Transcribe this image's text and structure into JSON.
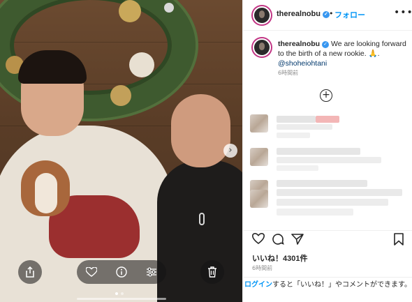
{
  "header": {
    "username": "therealnobu",
    "separator": "•",
    "follow_label": "フォロー",
    "more_label": "•••"
  },
  "caption": {
    "username": "therealnobu",
    "text": "We are looking forward to the birth of a new rookie.",
    "emoji": "🙏",
    "mention": "@shoheiohtani",
    "time": "6時間前"
  },
  "post": {
    "likes": "いいね！4301件",
    "time": "6時間前"
  },
  "footer": {
    "login_link": "ログイン",
    "login_text": "すると「いいね！」やコメントができます。"
  },
  "icons": {
    "verified": "verified-badge-icon",
    "add_comments": "plus-circle-icon",
    "like": "heart-icon",
    "comment": "comment-bubble-icon",
    "share": "paper-plane-icon",
    "save": "bookmark-icon",
    "photo_share": "share-icon",
    "photo_like": "heart-icon",
    "photo_info": "info-icon",
    "photo_adjust": "sliders-icon",
    "photo_delete": "trash-icon",
    "next": "chevron-right-icon"
  },
  "colors": {
    "link_blue": "#0095f6",
    "mention_blue": "#00376b",
    "verified_blue": "#3897f0",
    "text": "#262626",
    "muted": "#8e8e8e"
  }
}
